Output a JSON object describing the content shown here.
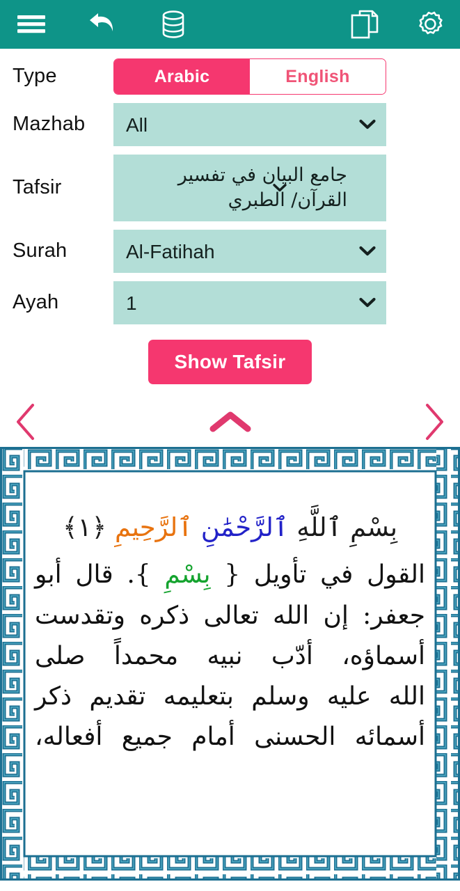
{
  "appbar": {
    "background": "#0E9488",
    "left_icons": [
      {
        "name": "menu-icon",
        "label": "Menu"
      },
      {
        "name": "undo-icon",
        "label": "Undo"
      },
      {
        "name": "database-icon",
        "label": "Database"
      }
    ],
    "right_icons": [
      {
        "name": "copy-pages-icon",
        "label": "Copy"
      },
      {
        "name": "gear-icon",
        "label": "Settings"
      }
    ]
  },
  "form": {
    "type": {
      "label": "Type",
      "options": [
        "Arabic",
        "English"
      ],
      "selected": "Arabic",
      "active_color": "#F5376F",
      "inactive_text_color": "#F05477"
    },
    "mazhab": {
      "label": "Mazhab",
      "value": "All"
    },
    "tafsir": {
      "label": "Tafsir",
      "value": "جامع البيان في تفسير القرآن/ الطبري"
    },
    "surah": {
      "label": "Surah",
      "value": "Al-Fatihah"
    },
    "ayah": {
      "label": "Ayah",
      "value": "1"
    },
    "submit": {
      "label": "Show Tafsir",
      "color": "#F5376F"
    },
    "field_background": "#B3DED7"
  },
  "navigation": {
    "previous": "chevron-left-icon",
    "scroll_up": "chevron-up-icon",
    "next": "chevron-right-icon",
    "color": "#E0396E"
  },
  "content": {
    "border_color": "#1C6F91",
    "verse": {
      "parts": [
        {
          "text": "بِسْمِ ",
          "color": "black"
        },
        {
          "text": "ٱللَّهِ ",
          "color": "black"
        },
        {
          "text": "ٱلرَّحْمَٰنِ ",
          "color": "black"
        },
        {
          "text": "ٱلرَّحِيمِ ",
          "color": "black"
        },
        {
          "text": "﴿١﴾",
          "color": "black"
        }
      ],
      "full_text": "بِسْمِ ٱللَّهِ ٱلرَّحْمَٰنِ ٱلرَّحِيمِ ﴿١﴾",
      "ayah_number": "١"
    },
    "tafsir_lines": [
      "القول في تأويل { بِسْمِ }. قال أبو",
      "جعفر: إن الله تعالى ذكره وتقدست",
      "أسماؤه، أدّب نبيه محمداً صلى",
      "الله عليه وسلم بتعليمه تقديم ذكر",
      "أسمائه الحسنى أمام جميع أفعاله،"
    ],
    "highlight_token": "بِسْمِ",
    "highlight_color": "#14a32e"
  }
}
